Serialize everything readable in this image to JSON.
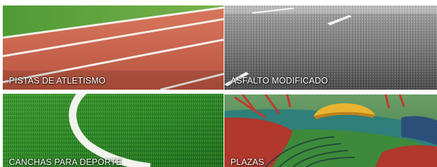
{
  "tiles": [
    {
      "label": "PISTAS DE ATLETISMO",
      "image": "running-track-photo"
    },
    {
      "label": "ASFALTO MODIFICADO",
      "image": "asphalt-road-photo"
    },
    {
      "label": "CANCHAS PARA DEPORTE",
      "image": "artificial-turf-field-photo"
    },
    {
      "label": "PLAZAS",
      "image": "playground-rubber-floor-photo"
    }
  ],
  "colors": {
    "track_red": "#c8614b",
    "turf_green": "#2f8a2a",
    "asphalt_gray": "#6d6d6d",
    "playground_red": "#b0382c",
    "playground_teal": "#2f7f7a",
    "playground_yellow": "#e8b430",
    "label_text": "#ffffff"
  }
}
